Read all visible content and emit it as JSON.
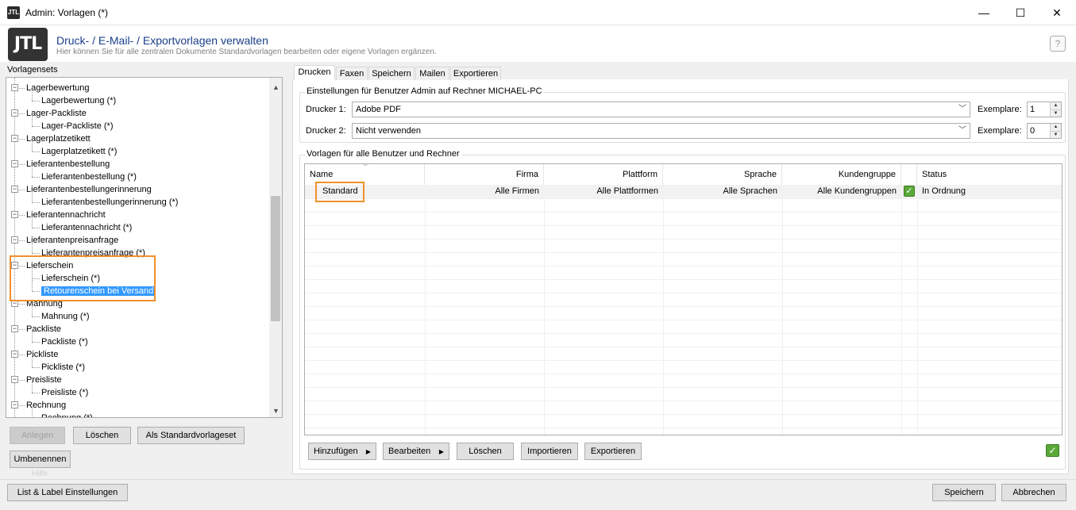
{
  "window": {
    "title": "Admin: Vorlagen (*)",
    "app_icon": "JTL",
    "minimize": "—",
    "maximize": "☐",
    "close": "✕"
  },
  "header": {
    "logo": "JTL",
    "title": "Druck- / E-Mail- / Exportvorlagen verwalten",
    "subtitle": "Hier können Sie für alle zentralen Dokumente Standardvorlagen bearbeiten oder eigene Vorlagen ergänzen.",
    "help_glyph": "?"
  },
  "left": {
    "label": "Vorlagensets",
    "tree": [
      {
        "label": "Lagerbewertung",
        "level": 0
      },
      {
        "label": "Lagerbewertung (*)",
        "level": 1
      },
      {
        "label": "Lager-Packliste",
        "level": 0
      },
      {
        "label": "Lager-Packliste (*)",
        "level": 1
      },
      {
        "label": "Lagerplatzetikett",
        "level": 0
      },
      {
        "label": "Lagerplatzetikett (*)",
        "level": 1
      },
      {
        "label": "Lieferantenbestellung",
        "level": 0
      },
      {
        "label": "Lieferantenbestellung (*)",
        "level": 1
      },
      {
        "label": "Lieferantenbestellungerinnerung",
        "level": 0
      },
      {
        "label": "Lieferantenbestellungerinnerung (*)",
        "level": 1
      },
      {
        "label": "Lieferantennachricht",
        "level": 0
      },
      {
        "label": "Lieferantennachricht (*)",
        "level": 1
      },
      {
        "label": "Lieferantenpreisanfrage",
        "level": 0
      },
      {
        "label": "Lieferantenpreisanfrage (*)",
        "level": 1
      },
      {
        "label": "Lieferschein",
        "level": 0
      },
      {
        "label": "Lieferschein (*)",
        "level": 1
      },
      {
        "label": "Retourenschein bei Versand",
        "level": 1,
        "selected": true
      },
      {
        "label": "Mahnung",
        "level": 0
      },
      {
        "label": "Mahnung (*)",
        "level": 1
      },
      {
        "label": "Packliste",
        "level": 0
      },
      {
        "label": "Packliste (*)",
        "level": 1
      },
      {
        "label": "Pickliste",
        "level": 0
      },
      {
        "label": "Pickliste (*)",
        "level": 1
      },
      {
        "label": "Preisliste",
        "level": 0
      },
      {
        "label": "Preisliste (*)",
        "level": 1
      },
      {
        "label": "Rechnung",
        "level": 0
      },
      {
        "label": "Rechnung (*)",
        "level": 1
      }
    ],
    "buttons": {
      "create": "Anlegen",
      "delete": "Löschen",
      "as_default": "Als Standardvorlageset",
      "rename": "Umbenennen"
    },
    "ghost_text": "Hilfe"
  },
  "tabs": [
    "Drucken",
    "Faxen",
    "Speichern",
    "Mailen",
    "Exportieren"
  ],
  "printer_group": {
    "label": "Einstellungen für Benutzer Admin auf Rechner MICHAEL-PC",
    "printer1_label": "Drucker 1:",
    "printer1_value": "Adobe PDF",
    "printer2_label": "Drucker 2:",
    "printer2_value": "Nicht verwenden",
    "copies_label": "Exemplare:",
    "copies1": "1",
    "copies2": "0"
  },
  "templates_group": {
    "label": "Vorlagen für alle Benutzer und Rechner",
    "columns": [
      "Name",
      "Firma",
      "Plattform",
      "Sprache",
      "Kundengruppe",
      "",
      "Status"
    ],
    "rows": [
      {
        "name": "Standard",
        "firma": "Alle Firmen",
        "plattform": "Alle Plattformen",
        "sprache": "Alle Sprachen",
        "kundengruppe": "Alle Kundengruppen",
        "status": "In Ordnung"
      }
    ]
  },
  "bottom_buttons": {
    "add": "Hinzufügen",
    "edit": "Bearbeiten",
    "delete": "Löschen",
    "import": "Importieren",
    "export": "Exportieren"
  },
  "footer": {
    "list_label": "List & Label Einstellungen",
    "save": "Speichern",
    "cancel": "Abbrechen"
  },
  "colors": {
    "highlight": "#f0902a",
    "selection": "#3399ff",
    "title_blue": "#1a3f8a",
    "ok_green": "#5ba839"
  }
}
